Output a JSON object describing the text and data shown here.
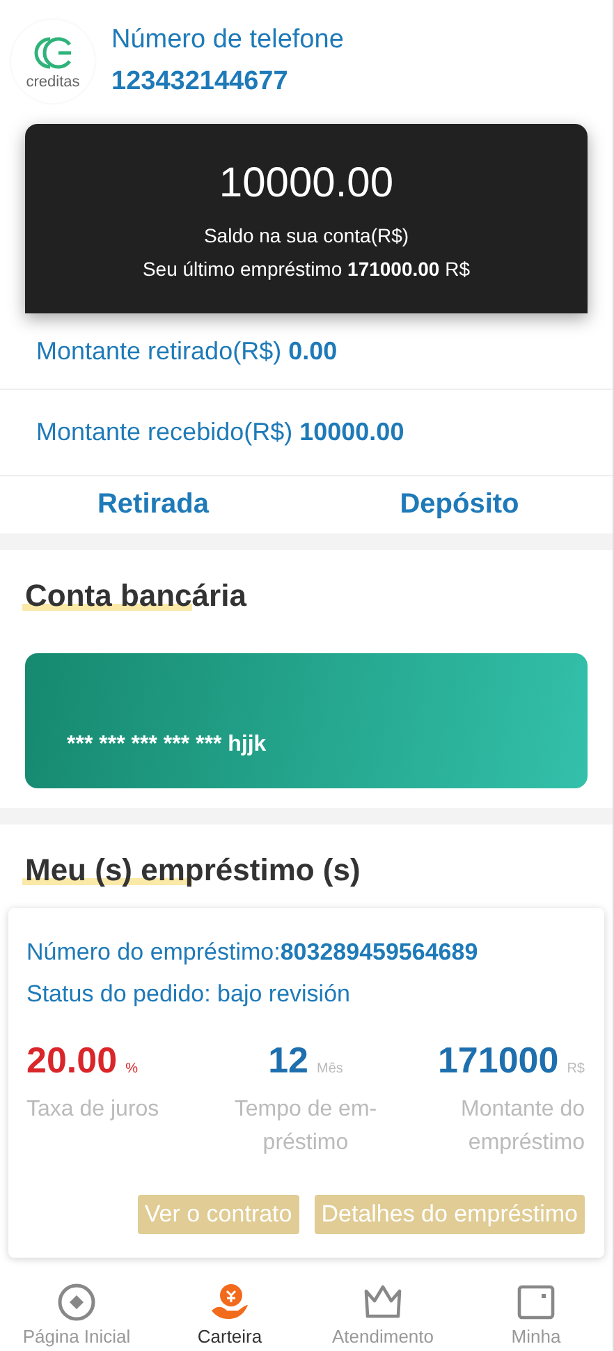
{
  "header": {
    "logo_text": "creditas",
    "phone_label": "Número de telefone",
    "phone": "123432144677"
  },
  "balance_card": {
    "amount": "10000.00",
    "caption": "Saldo na sua conta(R$)",
    "last_loan": "Seu último empréstimo **171000.00** R$"
  },
  "amounts": [
    {
      "label": "Montante retirado(R$)",
      "value": "0.00"
    },
    {
      "label": "Montante recebido(R$)",
      "value": "10000.00"
    }
  ],
  "actions": [
    "Retirada",
    "Depósito"
  ],
  "bank": {
    "title": "Conta bancária",
    "card_number": "*** *** *** *** *** hjjk"
  },
  "loans": {
    "title": "Meu (s) empréstimo (s)",
    "number_label": "Número do empréstimo:",
    "number": "803289459564689",
    "status": "Status do pedido: bajo revisión",
    "stats": [
      {
        "value": "20.00",
        "unit": "%",
        "label": "Taxa de juros",
        "kind": "rate"
      },
      {
        "value": "12",
        "unit": "Mês",
        "label": "Tempo de em-préstimo",
        "kind": "term"
      },
      {
        "value": "171000",
        "unit": "R$",
        "label": "Montante do empréstimo",
        "kind": "amount"
      }
    ],
    "buttons": [
      "Ver o contrato",
      "Detalhes do empréstimo"
    ]
  },
  "nav": [
    {
      "label": "Página Inicial",
      "selected": false,
      "kind": "home"
    },
    {
      "label": "Carteira",
      "selected": true,
      "kind": "wallet"
    },
    {
      "label": "Atendimento",
      "selected": false,
      "kind": "crown"
    },
    {
      "label": "Minha",
      "selected": false,
      "kind": "profile"
    }
  ]
}
